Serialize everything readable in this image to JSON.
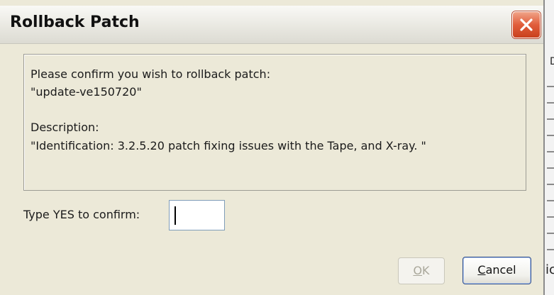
{
  "dialog": {
    "title": "Rollback Patch",
    "message_line1": "Please confirm you wish to rollback patch:",
    "patch_name": "\"update-ve150720\"",
    "description_label": "Description:",
    "description_text": "\"Identification: 3.2.5.20 patch fixing issues with the Tape, and X-ray. \"",
    "confirm_label": "Type YES to confirm:",
    "confirm_value": "",
    "ok_mnemonic": "O",
    "ok_rest": "K",
    "cancel_mnemonic": "C",
    "cancel_rest": "ancel"
  },
  "icons": {
    "close": "close-icon"
  },
  "colors": {
    "dialog_bg": "#ece9d8",
    "close_red": "#e15d3b",
    "input_border": "#7f9db9",
    "cancel_border": "#2e4d8a"
  },
  "background_app": {
    "glyph_top": "D",
    "glyph_bottom": "ic"
  }
}
